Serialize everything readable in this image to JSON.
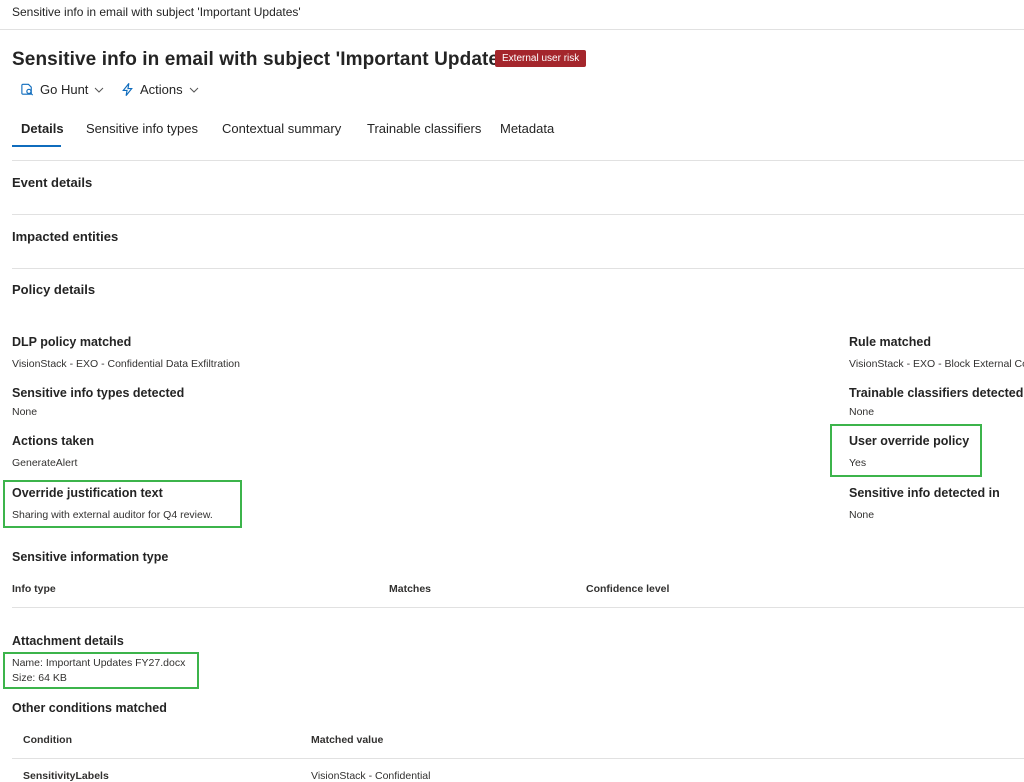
{
  "breadcrumb": "Sensitive info in email with subject 'Important Updates'",
  "header": {
    "title": "Sensitive info in email with subject 'Important Updates'",
    "badge": "External user risk",
    "colors": {
      "badge": "#a4262c",
      "accent": "#0f6cbd",
      "highlight": "#3cb44b"
    }
  },
  "commands": {
    "go_hunt": "Go Hunt",
    "actions": "Actions"
  },
  "tabs": [
    {
      "label": "Details",
      "active": true
    },
    {
      "label": "Sensitive info types"
    },
    {
      "label": "Contextual summary"
    },
    {
      "label": "Trainable classifiers"
    },
    {
      "label": "Metadata"
    }
  ],
  "sections": {
    "event_details": "Event details",
    "impacted_entities": "Impacted entities",
    "policy_details": "Policy details"
  },
  "details": {
    "dlp_policy_label": "DLP policy matched",
    "dlp_policy_value": "VisionStack - EXO - Confidential Data Exfiltration",
    "rule_label": "Rule matched",
    "rule_value": "VisionStack - EXO - Block External Co",
    "sit_label": "Sensitive info types detected",
    "sit_value": "None",
    "tc_label": "Trainable classifiers detected",
    "tc_value": "None",
    "actions_label": "Actions taken",
    "actions_value": "GenerateAlert",
    "override_label": "User override policy",
    "override_value": "Yes",
    "justification_label": "Override justification text",
    "justification_value": "Sharing with external auditor for Q4 review.",
    "detected_in_label": "Sensitive info detected in",
    "detected_in_value": "None"
  },
  "sit_table": {
    "title": "Sensitive information type",
    "columns": [
      "Info type",
      "Matches",
      "Confidence level"
    ]
  },
  "attachment": {
    "title": "Attachment details",
    "name": "Name: Important Updates FY27.docx",
    "size": "Size: 64 KB"
  },
  "other_conditions": {
    "title": "Other conditions matched",
    "columns": [
      "Condition",
      "Matched value"
    ],
    "rows": [
      {
        "condition": "SensitivityLabels",
        "value": "VisionStack - Confidential"
      }
    ]
  }
}
